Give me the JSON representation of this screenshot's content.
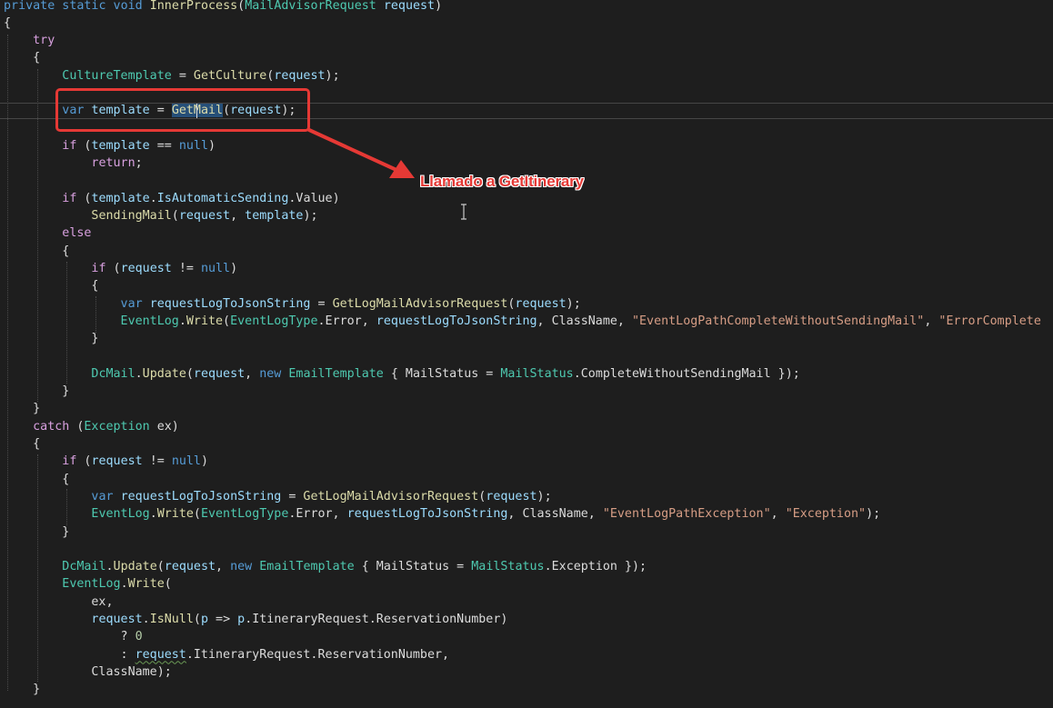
{
  "editor": {
    "theme": {
      "background": "#1e1e1e",
      "keyword": "#569cd6",
      "control_keyword": "#d8a0df",
      "type": "#4ec9b0",
      "method": "#dcdcaa",
      "identifier": "#9cdcfe",
      "string": "#d69d85",
      "number": "#b5cea8",
      "plain": "#dcdcdc",
      "selection": "#264f78"
    },
    "lines": [
      [
        [
          "kw",
          "private"
        ],
        [
          "pl",
          " "
        ],
        [
          "kw",
          "static"
        ],
        [
          "pl",
          " "
        ],
        [
          "kw",
          "void"
        ],
        [
          "pl",
          " "
        ],
        [
          "me",
          "InnerProcess"
        ],
        [
          "pl",
          "("
        ],
        [
          "ty",
          "MailAdvisorRequest"
        ],
        [
          "pl",
          " "
        ],
        [
          "id",
          "request"
        ],
        [
          "pl",
          ")"
        ]
      ],
      [
        [
          "pl",
          "{"
        ]
      ],
      [
        [
          "pl",
          "    "
        ],
        [
          "ct",
          "try"
        ]
      ],
      [
        [
          "pl",
          "    {"
        ]
      ],
      [
        [
          "pl",
          "        "
        ],
        [
          "ty",
          "CultureTemplate"
        ],
        [
          "pl",
          " = "
        ],
        [
          "me",
          "GetCulture"
        ],
        [
          "pl",
          "("
        ],
        [
          "id",
          "request"
        ],
        [
          "pl",
          ");"
        ]
      ],
      [
        [
          "pl",
          ""
        ]
      ],
      [
        [
          "pl",
          "        "
        ],
        [
          "kw",
          "var"
        ],
        [
          "pl",
          " "
        ],
        [
          "id",
          "template"
        ],
        [
          "pl",
          " = "
        ],
        [
          "sel",
          "GetMail"
        ],
        [
          "pl",
          "("
        ],
        [
          "id",
          "request"
        ],
        [
          "pl",
          ");"
        ]
      ],
      [
        [
          "pl",
          ""
        ]
      ],
      [
        [
          "pl",
          "        "
        ],
        [
          "ct",
          "if"
        ],
        [
          "pl",
          " ("
        ],
        [
          "id",
          "template"
        ],
        [
          "pl",
          " == "
        ],
        [
          "kw",
          "null"
        ],
        [
          "pl",
          ")"
        ]
      ],
      [
        [
          "pl",
          "            "
        ],
        [
          "ct",
          "return"
        ],
        [
          "pl",
          ";"
        ]
      ],
      [
        [
          "pl",
          ""
        ]
      ],
      [
        [
          "pl",
          "        "
        ],
        [
          "ct",
          "if"
        ],
        [
          "pl",
          " ("
        ],
        [
          "id",
          "template"
        ],
        [
          "pl",
          "."
        ],
        [
          "id",
          "IsAutomaticSending"
        ],
        [
          "pl",
          ".Value)"
        ]
      ],
      [
        [
          "pl",
          "            "
        ],
        [
          "me",
          "SendingMail"
        ],
        [
          "pl",
          "("
        ],
        [
          "id",
          "request"
        ],
        [
          "pl",
          ", "
        ],
        [
          "id",
          "template"
        ],
        [
          "pl",
          ");"
        ]
      ],
      [
        [
          "pl",
          "        "
        ],
        [
          "ct",
          "else"
        ]
      ],
      [
        [
          "pl",
          "        {"
        ]
      ],
      [
        [
          "pl",
          "            "
        ],
        [
          "ct",
          "if"
        ],
        [
          "pl",
          " ("
        ],
        [
          "id",
          "request"
        ],
        [
          "pl",
          " != "
        ],
        [
          "kw",
          "null"
        ],
        [
          "pl",
          ")"
        ]
      ],
      [
        [
          "pl",
          "            {"
        ]
      ],
      [
        [
          "pl",
          "                "
        ],
        [
          "kw",
          "var"
        ],
        [
          "pl",
          " "
        ],
        [
          "id",
          "requestLogToJsonString"
        ],
        [
          "pl",
          " = "
        ],
        [
          "me",
          "GetLogMailAdvisorRequest"
        ],
        [
          "pl",
          "("
        ],
        [
          "id",
          "request"
        ],
        [
          "pl",
          ");"
        ]
      ],
      [
        [
          "pl",
          "                "
        ],
        [
          "ty",
          "EventLog"
        ],
        [
          "pl",
          "."
        ],
        [
          "me",
          "Write"
        ],
        [
          "pl",
          "("
        ],
        [
          "ty",
          "EventLogType"
        ],
        [
          "pl",
          ".Error, "
        ],
        [
          "id",
          "requestLogToJsonString"
        ],
        [
          "pl",
          ", ClassName, "
        ],
        [
          "st",
          "\"EventLogPathCompleteWithoutSendingMail\""
        ],
        [
          "pl",
          ", "
        ],
        [
          "st",
          "\"ErrorComplete"
        ]
      ],
      [
        [
          "pl",
          "            }"
        ]
      ],
      [
        [
          "pl",
          ""
        ]
      ],
      [
        [
          "pl",
          "            "
        ],
        [
          "ty",
          "DcMail"
        ],
        [
          "pl",
          "."
        ],
        [
          "me",
          "Update"
        ],
        [
          "pl",
          "("
        ],
        [
          "id",
          "request"
        ],
        [
          "pl",
          ", "
        ],
        [
          "kw",
          "new"
        ],
        [
          "pl",
          " "
        ],
        [
          "ty",
          "EmailTemplate"
        ],
        [
          "pl",
          " { MailStatus = "
        ],
        [
          "ty",
          "MailStatus"
        ],
        [
          "pl",
          ".CompleteWithoutSendingMail });"
        ]
      ],
      [
        [
          "pl",
          "        }"
        ]
      ],
      [
        [
          "pl",
          "    }"
        ]
      ],
      [
        [
          "pl",
          "    "
        ],
        [
          "ct",
          "catch"
        ],
        [
          "pl",
          " ("
        ],
        [
          "ty",
          "Exception"
        ],
        [
          "pl",
          " ex)"
        ]
      ],
      [
        [
          "pl",
          "    {"
        ]
      ],
      [
        [
          "pl",
          "        "
        ],
        [
          "ct",
          "if"
        ],
        [
          "pl",
          " ("
        ],
        [
          "id",
          "request"
        ],
        [
          "pl",
          " != "
        ],
        [
          "kw",
          "null"
        ],
        [
          "pl",
          ")"
        ]
      ],
      [
        [
          "pl",
          "        {"
        ]
      ],
      [
        [
          "pl",
          "            "
        ],
        [
          "kw",
          "var"
        ],
        [
          "pl",
          " "
        ],
        [
          "id",
          "requestLogToJsonString"
        ],
        [
          "pl",
          " = "
        ],
        [
          "me",
          "GetLogMailAdvisorRequest"
        ],
        [
          "pl",
          "("
        ],
        [
          "id",
          "request"
        ],
        [
          "pl",
          ");"
        ]
      ],
      [
        [
          "pl",
          "            "
        ],
        [
          "ty",
          "EventLog"
        ],
        [
          "pl",
          "."
        ],
        [
          "me",
          "Write"
        ],
        [
          "pl",
          "("
        ],
        [
          "ty",
          "EventLogType"
        ],
        [
          "pl",
          ".Error, "
        ],
        [
          "id",
          "requestLogToJsonString"
        ],
        [
          "pl",
          ", ClassName, "
        ],
        [
          "st",
          "\"EventLogPathException\""
        ],
        [
          "pl",
          ", "
        ],
        [
          "st",
          "\"Exception\""
        ],
        [
          "pl",
          ");"
        ]
      ],
      [
        [
          "pl",
          "        }"
        ]
      ],
      [
        [
          "pl",
          ""
        ]
      ],
      [
        [
          "pl",
          "        "
        ],
        [
          "ty",
          "DcMail"
        ],
        [
          "pl",
          "."
        ],
        [
          "me",
          "Update"
        ],
        [
          "pl",
          "("
        ],
        [
          "id",
          "request"
        ],
        [
          "pl",
          ", "
        ],
        [
          "kw",
          "new"
        ],
        [
          "pl",
          " "
        ],
        [
          "ty",
          "EmailTemplate"
        ],
        [
          "pl",
          " { MailStatus = "
        ],
        [
          "ty",
          "MailStatus"
        ],
        [
          "pl",
          ".Exception });"
        ]
      ],
      [
        [
          "pl",
          "        "
        ],
        [
          "ty",
          "EventLog"
        ],
        [
          "pl",
          "."
        ],
        [
          "me",
          "Write"
        ],
        [
          "pl",
          "("
        ]
      ],
      [
        [
          "pl",
          "            ex,"
        ]
      ],
      [
        [
          "pl",
          "            "
        ],
        [
          "id",
          "request"
        ],
        [
          "pl",
          "."
        ],
        [
          "me",
          "IsNull"
        ],
        [
          "pl",
          "("
        ],
        [
          "id",
          "p"
        ],
        [
          "pl",
          " => "
        ],
        [
          "id",
          "p"
        ],
        [
          "pl",
          ".ItineraryRequest.ReservationNumber)"
        ]
      ],
      [
        [
          "pl",
          "                ? "
        ],
        [
          "nu",
          "0"
        ]
      ],
      [
        [
          "pl",
          "                : "
        ],
        [
          "sq",
          "request"
        ],
        [
          "pl",
          ".ItineraryRequest.ReservationNumber,"
        ]
      ],
      [
        [
          "pl",
          "            ClassName);"
        ]
      ],
      [
        [
          "pl",
          "    }"
        ]
      ]
    ]
  },
  "annotation": {
    "label": "Llamado a GetItinerary",
    "color": "#e53935"
  }
}
